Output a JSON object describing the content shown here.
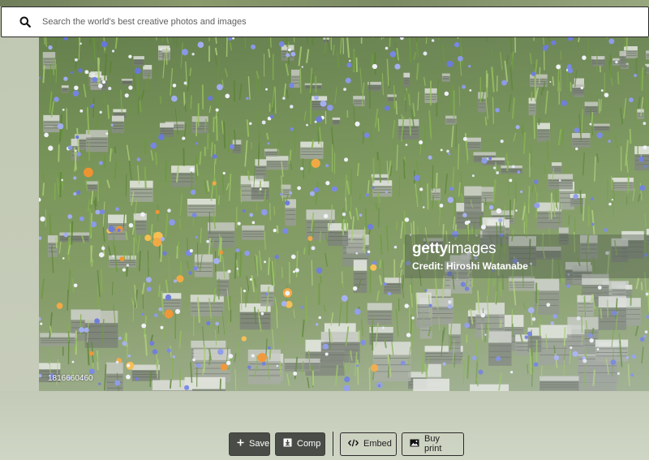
{
  "search": {
    "placeholder": "Search the world's best creative photos and images"
  },
  "photo": {
    "watermark_brand_bold": "getty",
    "watermark_brand_light": "images",
    "credit": "Credit: Hiroshi Watanabe",
    "image_id": "1816660460"
  },
  "actions": {
    "save_label": "Save",
    "comp_label": "Comp",
    "embed_label": "Embed",
    "buy_print_label": "Buy print"
  },
  "colors": {
    "primary_button": "#4a4d47",
    "search_border": "#2a2a2a"
  }
}
